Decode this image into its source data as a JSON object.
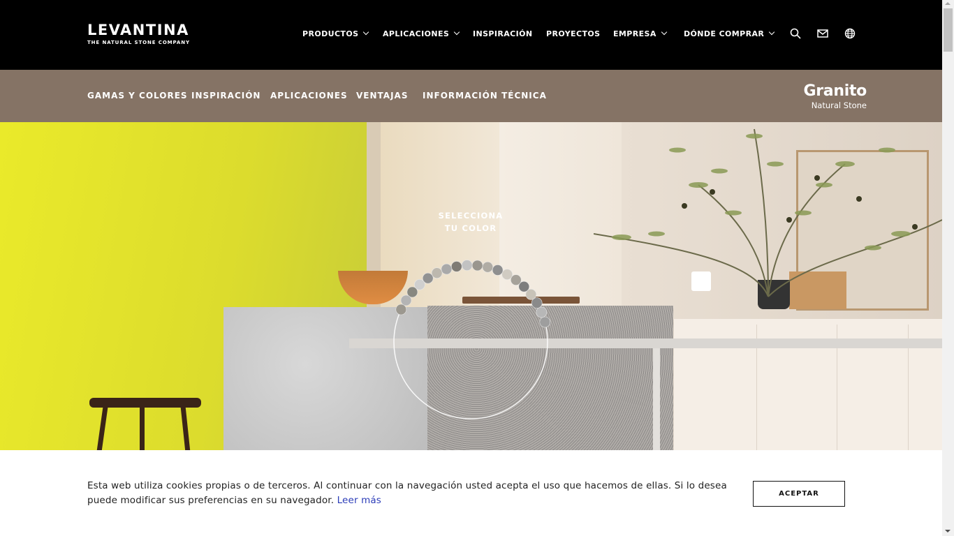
{
  "header": {
    "logo": {
      "main": "LEVANTINA",
      "sub": "THE NATURAL STONE COMPANY"
    },
    "nav": [
      {
        "label": "PRODUCTOS",
        "dropdown": true
      },
      {
        "label": "APLICACIONES",
        "dropdown": true
      },
      {
        "label": "INSPIRACIÓN",
        "dropdown": false
      },
      {
        "label": "PROYECTOS",
        "dropdown": false
      },
      {
        "label": "EMPRESA",
        "dropdown": true
      },
      {
        "label": "DÓNDE COMPRAR",
        "dropdown": true
      }
    ],
    "icons": [
      "search-icon",
      "mail-icon",
      "globe-icon"
    ]
  },
  "subnav": {
    "items": [
      "GAMAS Y COLORES",
      "INSPIRACIÓN",
      "APLICACIONES",
      "VENTAJAS",
      "INFORMACIÓN TÉCNICA"
    ],
    "brand": {
      "title": "Granito",
      "subtitle": "Natural Stone"
    }
  },
  "hero": {
    "selector_line1": "SELECCIONA",
    "selector_line2": "TU COLOR"
  },
  "cookie": {
    "text": "Esta web utiliza cookies propias o de terceros. Al continuar con la navegación usted acepta el uso que hacemos de ellas. Si lo desea puede modificar sus preferencias en su navegador.",
    "link": "Leer más",
    "button": "ACEPTAR"
  },
  "colors": {
    "topbar": "#000000",
    "subbar": "#857365",
    "link": "#2b3cb8"
  }
}
